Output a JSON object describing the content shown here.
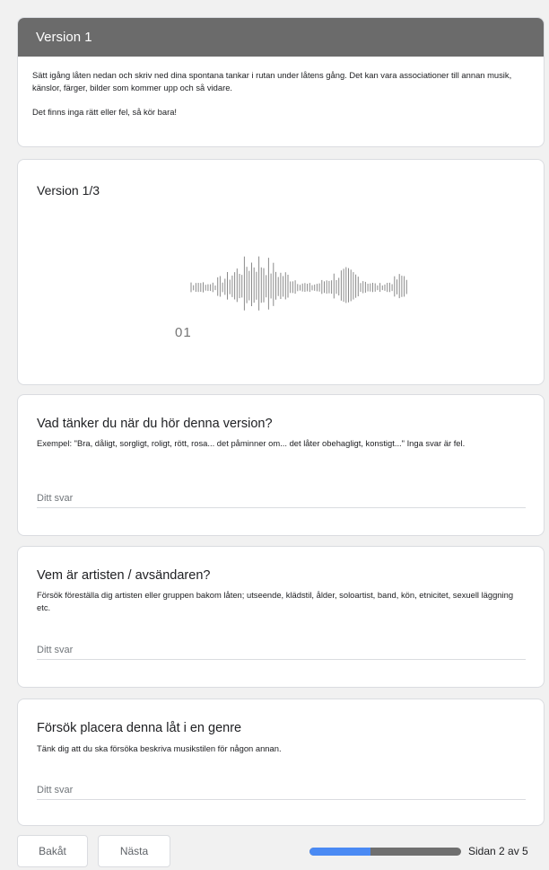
{
  "header": {
    "title": "Version 1",
    "paragraph1": "Sätt igång låten nedan och skriv ned dina spontana tankar i rutan under låtens gång. Det kan vara associationer till annan musik, känslor, färger, bilder som kommer upp och så vidare.",
    "paragraph2": "Det finns inga rätt eller fel, så kör bara!"
  },
  "media": {
    "title": "Version 1/3",
    "waveform_label": "01"
  },
  "questions": [
    {
      "title": "Vad tänker du när du hör denna version?",
      "description": "Exempel: \"Bra, dåligt, sorgligt, roligt, rött, rosa... det påminner om... det låter obehagligt, konstigt...\" Inga svar är fel.",
      "placeholder": "Ditt svar"
    },
    {
      "title": "Vem är artisten / avsändaren?",
      "description": "Försök föreställa dig artisten eller gruppen bakom låten; utseende, klädstil, ålder, soloartist, band, kön, etnicitet, sexuell läggning etc.",
      "placeholder": "Ditt svar"
    },
    {
      "title": "Försök placera denna låt i en genre",
      "description": "Tänk dig att du ska försöka beskriva musikstilen för någon annan.",
      "placeholder": "Ditt svar"
    }
  ],
  "footer": {
    "back_label": "Bakåt",
    "next_label": "Nästa",
    "page_label": "Sidan 2 av 5",
    "progress": 0.4
  },
  "colors": {
    "header_bg": "#6b6b6b",
    "progress_fill": "#4a8af4",
    "progress_track": "#6f6f6f"
  }
}
